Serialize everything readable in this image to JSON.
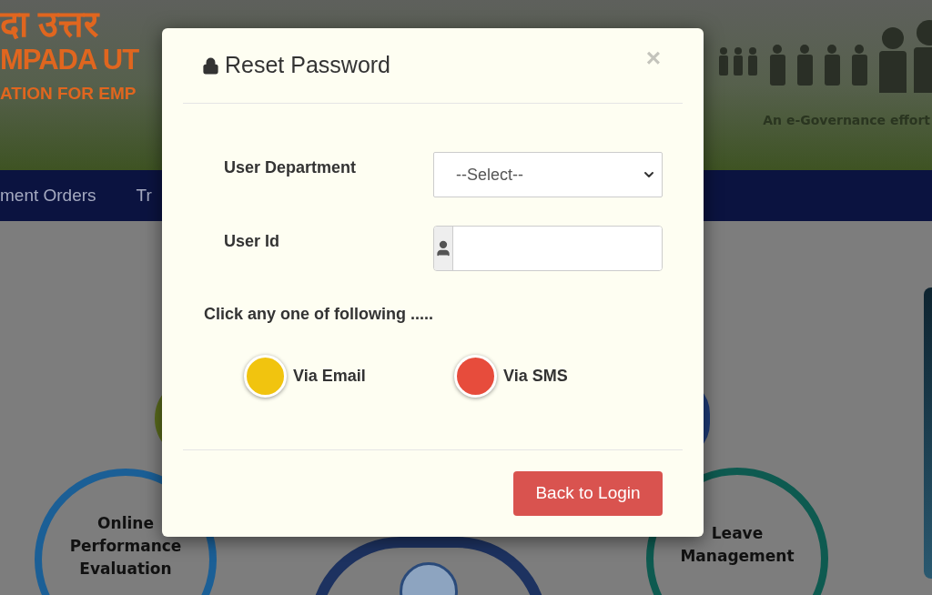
{
  "banner": {
    "hindi_title": "दा उत्तर",
    "title": "MPADA UT",
    "subtitle": "ATION FOR EMP",
    "tagline": "An e-Governance effort"
  },
  "nav": {
    "items": [
      "ment Orders",
      "Tr"
    ]
  },
  "background_tiles": [
    {
      "label": "Online Performance Evaluation",
      "color": "#1b5f96"
    },
    {
      "label": "Leave Management",
      "color": "#0e5a50"
    }
  ],
  "dialog": {
    "title": "Reset Password",
    "close": "×",
    "fields": [
      {
        "kind": "select",
        "label": "User Department",
        "value": "--Select--"
      },
      {
        "kind": "text",
        "label": "User Id"
      }
    ],
    "prompt": "Click any one of following .....",
    "options": [
      {
        "label": "Via Email",
        "color": "#f1c40f"
      },
      {
        "label": "Via SMS",
        "color": "#e74c3c"
      }
    ],
    "buttons": [
      "Back to Login"
    ]
  }
}
